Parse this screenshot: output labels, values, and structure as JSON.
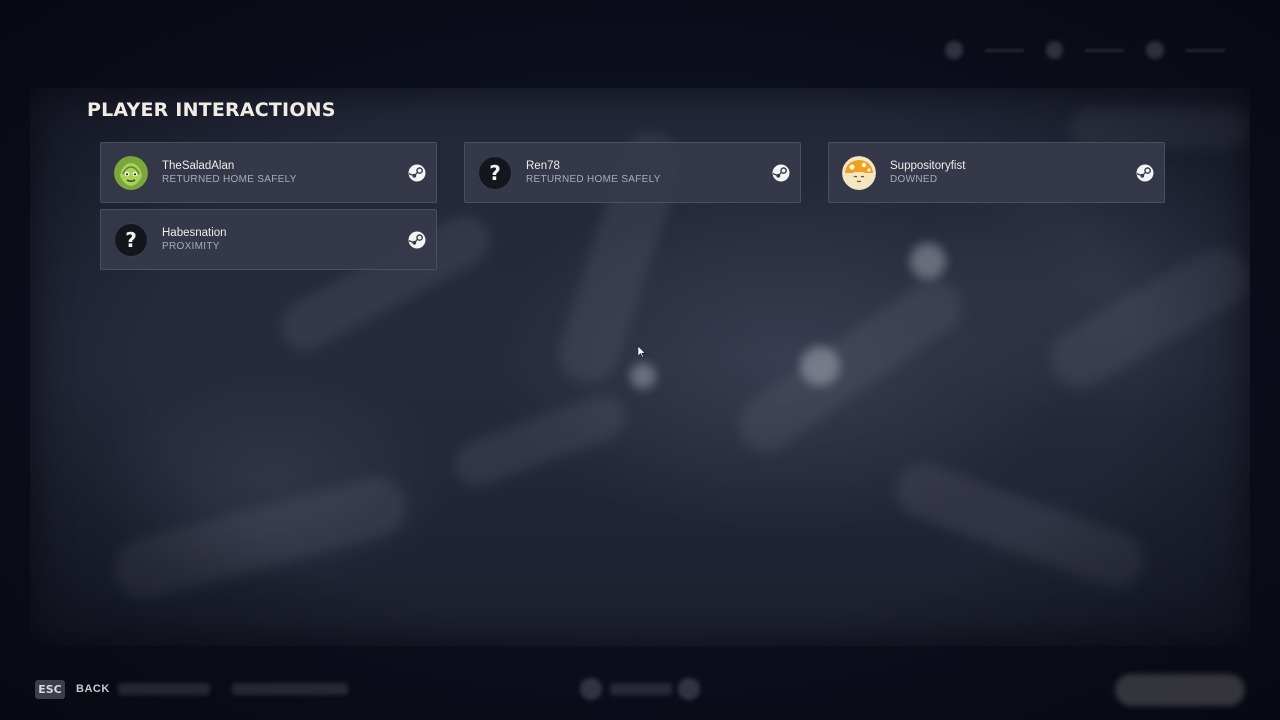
{
  "section": {
    "title": "PLAYER INTERACTIONS"
  },
  "players": [
    {
      "name": "TheSaladAlan",
      "status": "RETURNED HOME SAFELY",
      "avatar": "lettuce-avatar"
    },
    {
      "name": "Ren78",
      "status": "RETURNED HOME SAFELY",
      "avatar": "unknown-avatar",
      "avatar_glyph": "?"
    },
    {
      "name": "Suppositoryfist",
      "status": "DOWNED",
      "avatar": "mushroom-avatar"
    },
    {
      "name": "Habesnation",
      "status": "PROXIMITY",
      "avatar": "unknown-avatar",
      "avatar_glyph": "?"
    }
  ],
  "footer": {
    "esc_key": "ESC",
    "back_label": "BACK"
  },
  "icons": {
    "profile_link": "steam-icon"
  },
  "colors": {
    "background": "#0c0f1c",
    "card": "#363a4a",
    "title": "#f1ece2",
    "status_text": "#a9acb6"
  }
}
